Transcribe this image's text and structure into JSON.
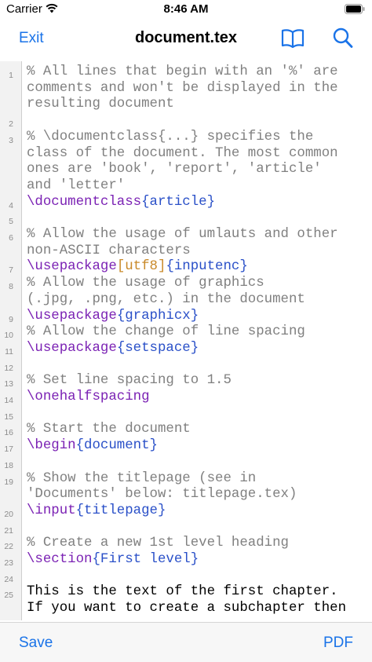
{
  "status_bar": {
    "carrier": "Carrier",
    "time": "8:46 AM"
  },
  "navbar": {
    "exit_label": "Exit",
    "title": "document.tex",
    "book_icon": "book-icon",
    "search_icon": "search-icon"
  },
  "editor": {
    "lines": [
      {
        "n": "1",
        "parts": [
          {
            "c": "c",
            "t": "% All lines that begin with an '%' are"
          }
        ]
      },
      {
        "n": "",
        "parts": [
          {
            "c": "c",
            "t": "comments and won't be displayed in the"
          }
        ]
      },
      {
        "n": "",
        "parts": [
          {
            "c": "c",
            "t": "resulting document"
          }
        ]
      },
      {
        "n": "2",
        "parts": []
      },
      {
        "n": "3",
        "parts": [
          {
            "c": "c",
            "t": "% \\documentclass{...} specifies the"
          }
        ]
      },
      {
        "n": "",
        "parts": [
          {
            "c": "c",
            "t": "class of the document. The most common"
          }
        ]
      },
      {
        "n": "",
        "parts": [
          {
            "c": "c",
            "t": "ones are 'book', 'report', 'article'"
          }
        ]
      },
      {
        "n": "",
        "parts": [
          {
            "c": "c",
            "t": "and 'letter'"
          }
        ]
      },
      {
        "n": "4",
        "parts": [
          {
            "c": "k",
            "t": "\\documentclass"
          },
          {
            "c": "a",
            "t": "{article}"
          }
        ]
      },
      {
        "n": "5",
        "parts": []
      },
      {
        "n": "6",
        "parts": [
          {
            "c": "c",
            "t": "% Allow the usage of umlauts and other"
          }
        ]
      },
      {
        "n": "",
        "parts": [
          {
            "c": "c",
            "t": "non-ASCII characters"
          }
        ]
      },
      {
        "n": "7",
        "parts": [
          {
            "c": "k",
            "t": "\\usepackage"
          },
          {
            "c": "o",
            "t": "[utf8]"
          },
          {
            "c": "a",
            "t": "{inputenc}"
          }
        ]
      },
      {
        "n": "8",
        "parts": [
          {
            "c": "c",
            "t": "% Allow the usage of graphics"
          }
        ]
      },
      {
        "n": "",
        "parts": [
          {
            "c": "c",
            "t": "(.jpg, .png, etc.) in the document"
          }
        ]
      },
      {
        "n": "9",
        "parts": [
          {
            "c": "k",
            "t": "\\usepackage"
          },
          {
            "c": "a",
            "t": "{graphicx}"
          }
        ]
      },
      {
        "n": "10",
        "parts": [
          {
            "c": "c",
            "t": "% Allow the change of line spacing"
          }
        ]
      },
      {
        "n": "11",
        "parts": [
          {
            "c": "k",
            "t": "\\usepackage"
          },
          {
            "c": "a",
            "t": "{setspace}"
          }
        ]
      },
      {
        "n": "12",
        "parts": []
      },
      {
        "n": "13",
        "parts": [
          {
            "c": "c",
            "t": "% Set line spacing to 1.5"
          }
        ]
      },
      {
        "n": "14",
        "parts": [
          {
            "c": "k",
            "t": "\\onehalfspacing"
          }
        ]
      },
      {
        "n": "15",
        "parts": []
      },
      {
        "n": "16",
        "parts": [
          {
            "c": "c",
            "t": "% Start the document"
          }
        ]
      },
      {
        "n": "17",
        "parts": [
          {
            "c": "k",
            "t": "\\begin"
          },
          {
            "c": "a",
            "t": "{document}"
          }
        ]
      },
      {
        "n": "18",
        "parts": []
      },
      {
        "n": "19",
        "parts": [
          {
            "c": "c",
            "t": "% Show the titlepage (see in"
          }
        ]
      },
      {
        "n": "",
        "parts": [
          {
            "c": "c",
            "t": "'Documents' below: titlepage.tex)"
          }
        ]
      },
      {
        "n": "20",
        "parts": [
          {
            "c": "k",
            "t": "\\input"
          },
          {
            "c": "a",
            "t": "{titlepage}"
          }
        ]
      },
      {
        "n": "21",
        "parts": []
      },
      {
        "n": "22",
        "parts": [
          {
            "c": "c",
            "t": "% Create a new 1st level heading"
          }
        ]
      },
      {
        "n": "23",
        "parts": [
          {
            "c": "k",
            "t": "\\section"
          },
          {
            "c": "a",
            "t": "{First level}"
          }
        ]
      },
      {
        "n": "24",
        "parts": []
      },
      {
        "n": "25",
        "parts": [
          {
            "c": "t",
            "t": "This is the text of the first chapter."
          }
        ]
      },
      {
        "n": "",
        "parts": [
          {
            "c": "t",
            "t": "If you want to create a subchapter then"
          }
        ]
      }
    ]
  },
  "toolbar": {
    "save_label": "Save",
    "pdf_label": "PDF"
  },
  "colors": {
    "accent": "#1a73e8",
    "comment": "#808080",
    "command": "#7b22b4",
    "argument": "#2a50c8",
    "option": "#c98a2a"
  }
}
